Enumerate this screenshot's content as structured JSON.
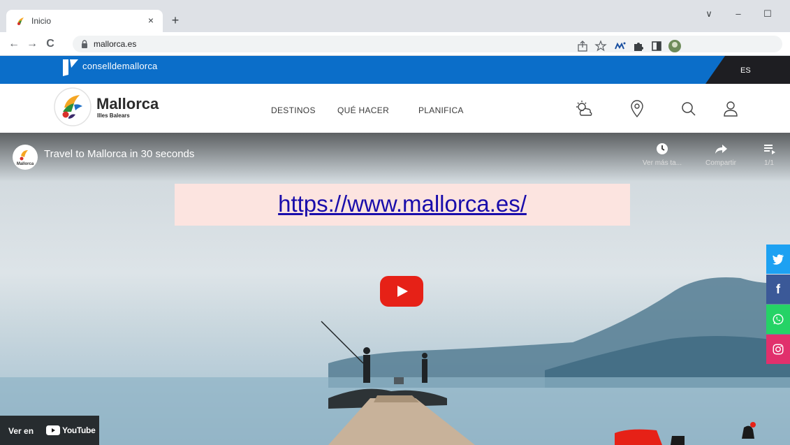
{
  "browser": {
    "tab_title": "Inicio",
    "tab_close": "×",
    "new_tab": "+",
    "window": {
      "dropdown": "∨",
      "minimize": "–",
      "maximize": "☐"
    },
    "nav": {
      "back": "←",
      "forward": "→",
      "reload": "C"
    },
    "url": "mallorca.es",
    "toolbar_icons": [
      "share-icon",
      "star-icon",
      "extension-mv-icon",
      "puzzle-icon",
      "side-panel-icon",
      "profile-avatar-icon"
    ]
  },
  "consell": {
    "name": "conselldemallorca",
    "language": "ES"
  },
  "site": {
    "brand_name": "Mallorca",
    "brand_subtitle": "Illes Balears",
    "nav": [
      "DESTINOS",
      "QUÉ HACER",
      "PLANIFICA"
    ],
    "header_icons": [
      "weather-icon",
      "location-pin-icon",
      "search-icon",
      "user-icon"
    ]
  },
  "video": {
    "title": "Travel to Mallorca in 30 seconds",
    "channel_avatar_text": "Mallorca",
    "controls": [
      {
        "icon": "clock-icon",
        "label": "Ver más ta..."
      },
      {
        "icon": "share-arrow-icon",
        "label": "Compartir"
      },
      {
        "icon": "playlist-icon",
        "label": "1/1"
      }
    ],
    "overlay_url": "https://www.mallorca.es/",
    "watch_on": "Ver en",
    "youtube_word": "YouTube"
  },
  "social": [
    {
      "icon": "twitter-icon",
      "glyph": "🐦",
      "color": "#1da1f2"
    },
    {
      "icon": "facebook-icon",
      "glyph": "f",
      "color": "#3b5998"
    },
    {
      "icon": "whatsapp-icon",
      "glyph": "✆",
      "color": "#25d366"
    },
    {
      "icon": "instagram-icon",
      "glyph": "◎",
      "color": "#e1306c"
    }
  ],
  "colors": {
    "consell_blue": "#0b6ec9",
    "youtube_red": "#e62117",
    "tabstrip": "#dee1e6"
  }
}
